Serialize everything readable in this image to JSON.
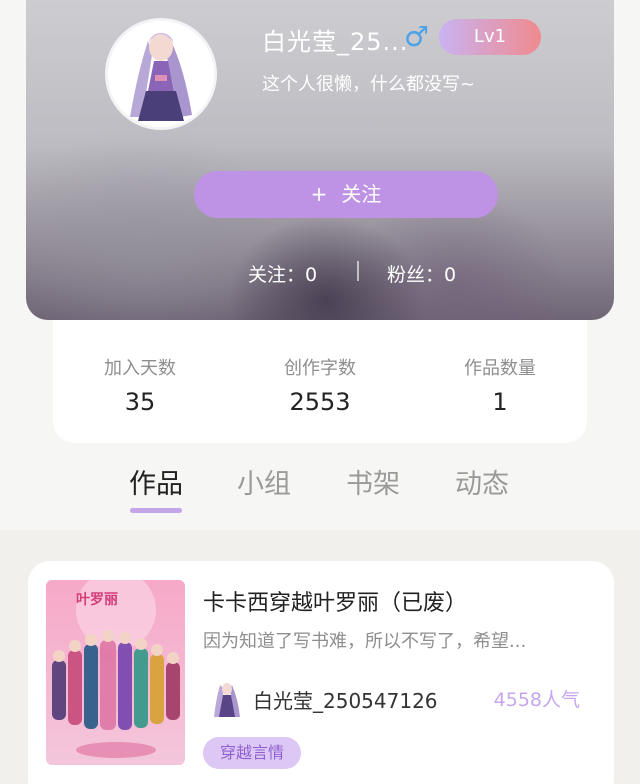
{
  "profile": {
    "username": "白光莹_25...",
    "gender_icon": "male-icon",
    "gender_symbol": "♂",
    "level": "Lv1",
    "bio": "这个人很懒，什么都没写~",
    "follow_button": "关注",
    "follow_plus": "+",
    "following_label": "关注：0",
    "fans_label": "粉丝：0"
  },
  "stats": [
    {
      "label": "加入天数",
      "value": "35"
    },
    {
      "label": "创作字数",
      "value": "2553"
    },
    {
      "label": "作品数量",
      "value": "1"
    }
  ],
  "tabs": [
    {
      "label": "作品",
      "active": true
    },
    {
      "label": "小组",
      "active": false
    },
    {
      "label": "书架",
      "active": false
    },
    {
      "label": "动态",
      "active": false
    }
  ],
  "work": {
    "title": "卡卡西穿越叶罗丽（已废）",
    "description": "因为知道了写书难，所以不写了，希望...",
    "author": "白光莹_250547126",
    "popularity": "4558人气",
    "tag": "穿越言情",
    "cover_logo_text": "叶罗丽"
  },
  "colors": {
    "accent": "#be93e6",
    "level_start": "#c9b3f2",
    "level_end": "#f08a8e",
    "gender": "#4ea3e8",
    "popularity": "#c6a6ec"
  }
}
